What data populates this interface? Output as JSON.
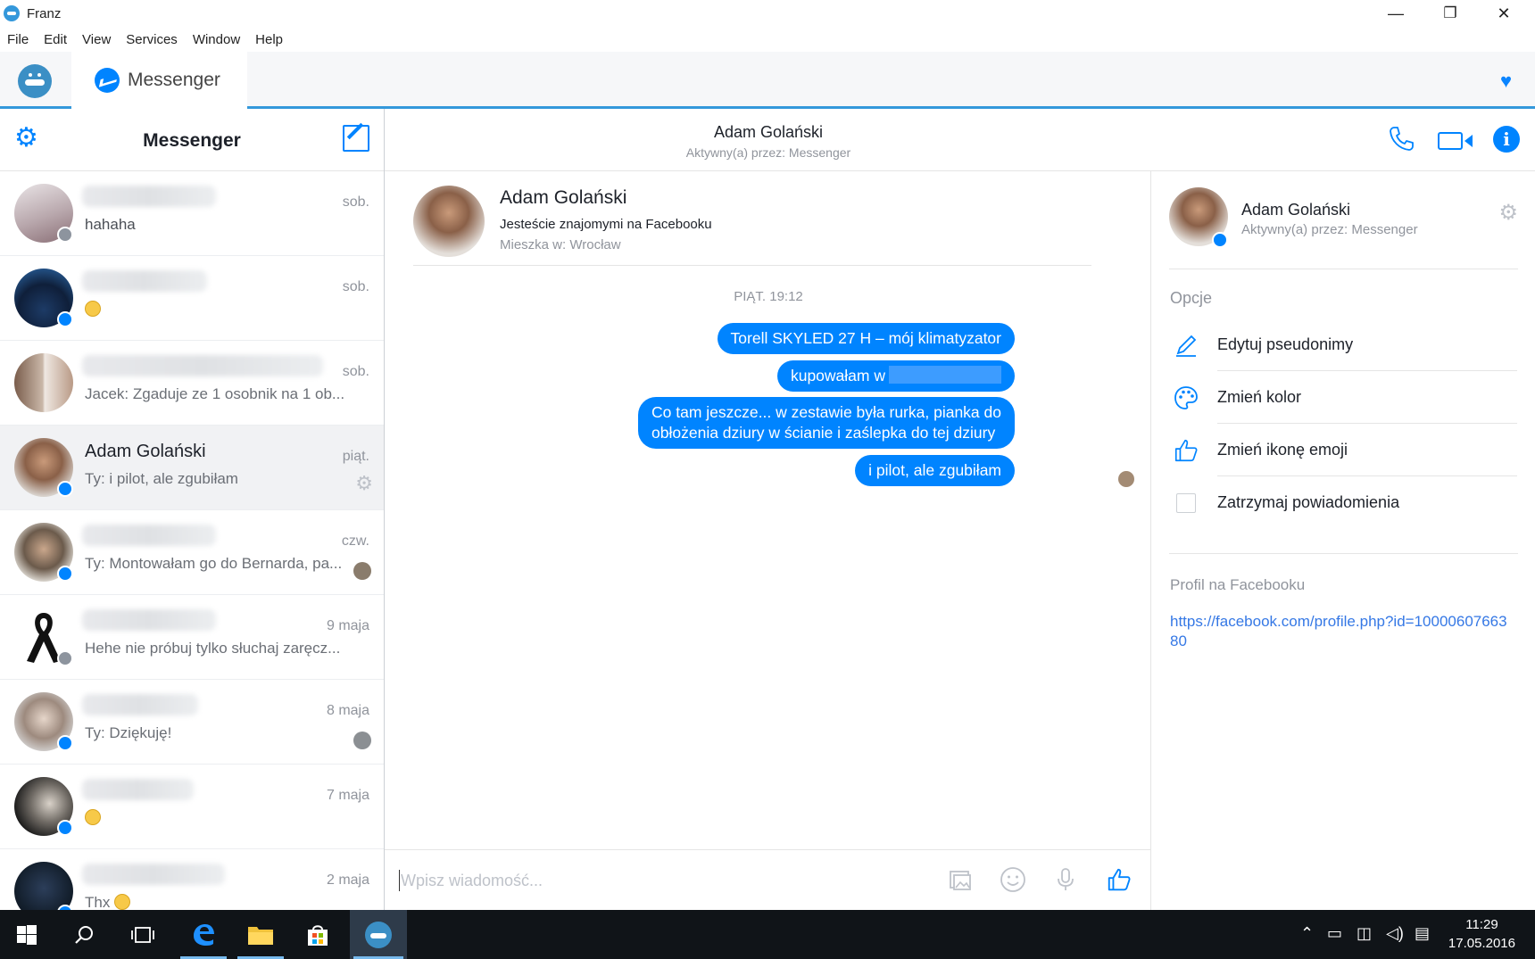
{
  "window": {
    "title": "Franz",
    "minimize": "—",
    "maximize": "❐",
    "close": "✕"
  },
  "menu": [
    "File",
    "Edit",
    "View",
    "Services",
    "Window",
    "Help"
  ],
  "franz": {
    "tab_label": "Messenger",
    "heart": "♥"
  },
  "sidebar": {
    "title": "Messenger",
    "conversations": [
      {
        "name": "",
        "time": "sob.",
        "snippet": "hahaha",
        "badge": "fb"
      },
      {
        "name": "",
        "time": "sob.",
        "snippet": "",
        "emoji": true,
        "badge": "msn"
      },
      {
        "name": "",
        "time": "sob.",
        "snippet": "Jacek: Zgaduje ze 1 osobnik na 1 ob...",
        "badge": "none"
      },
      {
        "name": "Adam Golański",
        "time": "piąt.",
        "snippet": "Ty: i pilot, ale zgubiłam",
        "badge": "msn",
        "active": true
      },
      {
        "name": "",
        "time": "czw.",
        "snippet": "Ty: Montowałam go do Bernarda, pa...",
        "badge": "msn"
      },
      {
        "name": "",
        "time": "9 maja",
        "snippet": "Hehe nie próbuj tylko słuchaj zaręcz...",
        "badge": "fb"
      },
      {
        "name": "",
        "time": "8 maja",
        "snippet": "Ty: Dziękuję!",
        "badge": "msn"
      },
      {
        "name": "",
        "time": "7 maja",
        "snippet": "",
        "emoji": true,
        "badge": "msn"
      },
      {
        "name": "",
        "time": "2 maja",
        "snippet": "Thx",
        "emoji": true,
        "badge": "msn"
      }
    ]
  },
  "chat": {
    "header_name": "Adam Golański",
    "header_status": "Aktywny(a) przez: Messenger",
    "card_name": "Adam Golański",
    "card_friends": "Jesteście znajomymi na Facebooku",
    "card_lives": "Mieszka w: Wrocław",
    "day_separator": "PIĄT. 19:12",
    "messages": [
      "Torell SKYLED 27 H – mój klimatyzator",
      "kupowałam w",
      "Co tam jeszcze... w zestawie była rurka, pianka do",
      "obłożenia dziury w ścianie i zaślepka do tej dziury",
      "i pilot, ale zgubiłam"
    ],
    "composer_placeholder": "Wpisz wiadomość..."
  },
  "info": {
    "name": "Adam Golański",
    "status": "Aktywny(a) przez: Messenger",
    "options_title": "Opcje",
    "options": [
      "Edytuj pseudonimy",
      "Zmień kolor",
      "Zmień ikonę emoji",
      "Zatrzymaj powiadomienia"
    ],
    "profile_title": "Profil na Facebooku",
    "profile_url": "https://facebook.com/profile.php?id=1000060766380"
  },
  "taskbar": {
    "time": "11:29",
    "date": "17.05.2016"
  },
  "colors": {
    "accent": "#0084ff",
    "franz": "#3498db",
    "taskbar": "#101418"
  }
}
